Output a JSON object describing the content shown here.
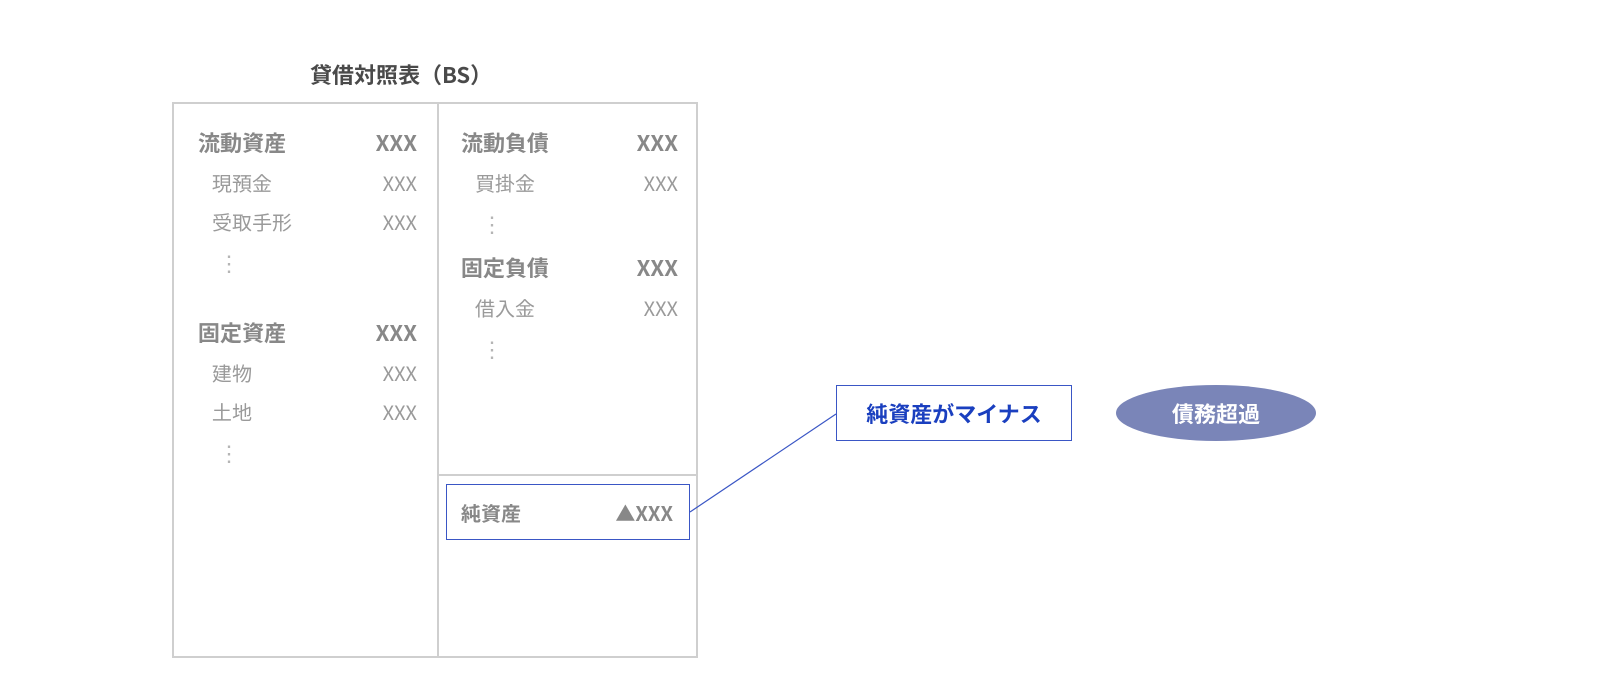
{
  "title": "貸借対照表（BS）",
  "placeholder": "XXX",
  "neg_placeholder": "▲XXX",
  "vdots": "⋮",
  "assets": {
    "current": {
      "heading": "流動資産",
      "items": [
        {
          "label": "現預金"
        },
        {
          "label": "受取手形"
        }
      ]
    },
    "fixed": {
      "heading": "固定資産",
      "items": [
        {
          "label": "建物"
        },
        {
          "label": "土地"
        }
      ]
    }
  },
  "liabilities": {
    "current": {
      "heading": "流動負債",
      "items": [
        {
          "label": "買掛金"
        }
      ]
    },
    "fixed": {
      "heading": "固定負債",
      "items": [
        {
          "label": "借入金"
        }
      ]
    }
  },
  "net_assets": {
    "heading": "純資産"
  },
  "callout": "純資産がマイナス",
  "badge": "債務超過",
  "colors": {
    "accent_blue": "#3a56c5",
    "text_blue": "#1a3fbf",
    "oval_bg": "#7a85b8",
    "border_gray": "#cfcfcf",
    "text_gray": "#888888"
  }
}
